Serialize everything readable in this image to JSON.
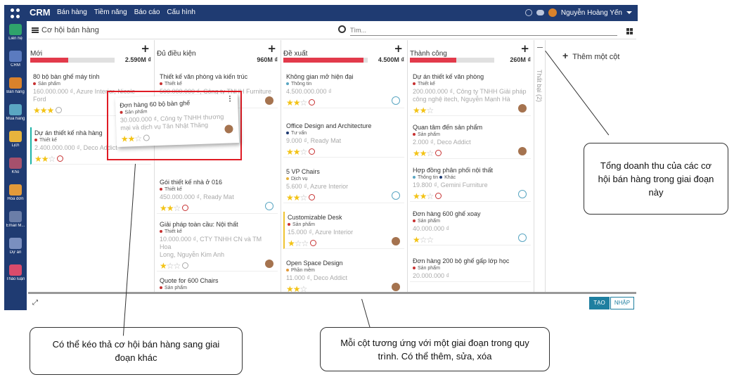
{
  "topbar": {
    "brand": "CRM",
    "menu": [
      "Bán hàng",
      "Tiềm năng",
      "Báo cáo",
      "Cấu hình"
    ],
    "user": "Nguyễn Hoàng Yến"
  },
  "sidebar": [
    {
      "label": "Liên hệ",
      "color": "#2fa36b"
    },
    {
      "label": "CRM",
      "color": "#5b7bbf"
    },
    {
      "label": "Bán hàng",
      "color": "#d9822b"
    },
    {
      "label": "Mua hàng",
      "color": "#5aa6c2"
    },
    {
      "label": "Lịch",
      "color": "#e6b33d"
    },
    {
      "label": "Kho",
      "color": "#a5506c"
    },
    {
      "label": "Hóa đơn",
      "color": "#e29a3a"
    },
    {
      "label": "Email M...",
      "color": "#6b7ea8"
    },
    {
      "label": "Dự án",
      "color": "#7a8fbf"
    },
    {
      "label": "Thảo luận",
      "color": "#d94b6b"
    }
  ],
  "breadcrumb": {
    "title": "Cơ hội bán hàng",
    "search_placeholder": "Tìm..."
  },
  "columns": [
    {
      "name": "Mới",
      "total": "2.590M ₫",
      "progress": 0.45,
      "cards": [
        {
          "title": "80 bộ bàn ghế máy tính",
          "tags": [
            {
              "text": "Sản phẩm",
              "color": "#c73131"
            }
          ],
          "info": [
            "160.000.000 ₫, Azure Interior, Nicole",
            "Ford"
          ],
          "stars": 3,
          "activity": "grey",
          "avatar": "none",
          "border": ""
        },
        {
          "title": "Dự án thiết kế nhà hàng",
          "tags": [
            {
              "text": "Thiết kế",
              "color": "#c73131"
            }
          ],
          "info": [
            "2.400.000.000 ₫, Deco Addict"
          ],
          "stars": 2,
          "activity": "red",
          "avatar": "none",
          "border": "green"
        }
      ]
    },
    {
      "name": "Đủ điều kiện",
      "total": "960M ₫",
      "progress": 0,
      "cards": [
        {
          "title": "Thiết kế văn phòng và kiến trúc",
          "tags": [
            {
              "text": "Thiết kế",
              "color": "#c73131"
            }
          ],
          "info": [
            "500.000.000 ₫, Công ty TNHH Furniture"
          ],
          "stars": 0,
          "activity": "none",
          "avatar": "photo",
          "border": ""
        },
        {
          "title": "Gói thiết kế nhà ở 016",
          "tags": [
            {
              "text": "Thiết kế",
              "color": "#c73131"
            }
          ],
          "info": [
            "450.000.000 ₫, Ready Mat"
          ],
          "stars": 2,
          "activity": "red",
          "avatar": "ring",
          "border": ""
        },
        {
          "title": "Giải pháp toàn cầu: Nội thất",
          "tags": [
            {
              "text": "Thiết kế",
              "color": "#c73131"
            }
          ],
          "info": [
            "10.000.000 ₫, CTY TNHH CN và TM Hoa",
            "Long, Nguyễn Kim Anh"
          ],
          "stars": 1,
          "activity": "grey",
          "avatar": "photo",
          "border": ""
        },
        {
          "title": "Quote for 600 Chairs",
          "tags": [
            {
              "text": "Sản phẩm",
              "color": "#c73131"
            }
          ],
          "info": [],
          "stars": 0,
          "activity": "none",
          "avatar": "none",
          "border": ""
        }
      ]
    },
    {
      "name": "Đề xuất",
      "total": "4.500M ₫",
      "progress": 0.95,
      "cards": [
        {
          "title": "Không gian mở hiện đại",
          "tags": [
            {
              "text": "Thông tin",
              "color": "#5aa6c2"
            }
          ],
          "info": [
            "4.500.000.000 ₫"
          ],
          "stars": 2,
          "activity": "red",
          "avatar": "ring",
          "border": ""
        },
        {
          "title": "Office Design and Architecture",
          "tags": [
            {
              "text": "Tư vấn",
              "color": "#1f3b72"
            }
          ],
          "info": [
            "9.000 ₫, Ready Mat"
          ],
          "stars": 2,
          "activity": "red",
          "avatar": "none",
          "border": ""
        },
        {
          "title": "5 VP Chairs",
          "tags": [
            {
              "text": "Dịch vụ",
              "color": "#e6b33d"
            }
          ],
          "info": [
            "5.600 ₫, Azure Interior"
          ],
          "stars": 2,
          "activity": "red",
          "avatar": "ring",
          "border": ""
        },
        {
          "title": "Customizable Desk",
          "tags": [
            {
              "text": "Sản phẩm",
              "color": "#c73131"
            }
          ],
          "info": [
            "15.000 ₫, Azure Interior"
          ],
          "stars": 1,
          "activity": "red",
          "avatar": "photo",
          "border": "yellow"
        },
        {
          "title": "Open Space Design",
          "tags": [
            {
              "text": "Phần mềm",
              "color": "#e29a3a"
            }
          ],
          "info": [
            "11.000 ₫, Deco Addict"
          ],
          "stars": 2,
          "activity": "none",
          "avatar": "photo",
          "border": ""
        }
      ]
    },
    {
      "name": "Thành công",
      "total": "260M ₫",
      "progress": 0.55,
      "cards": [
        {
          "title": "Dự án thiết kế văn phòng",
          "tags": [
            {
              "text": "Thiết kế",
              "color": "#c73131"
            }
          ],
          "info": [
            "200.000.000 ₫, Công ty TNHH Giải pháp",
            "công nghệ itech, Nguyễn Mạnh Hà"
          ],
          "stars": 2,
          "activity": "none",
          "avatar": "photo",
          "border": ""
        },
        {
          "title": "Quan tâm đến sản phẩm",
          "tags": [
            {
              "text": "Sản phẩm",
              "color": "#c73131"
            }
          ],
          "info": [
            "2.000 ₫, Deco Addict"
          ],
          "stars": 2,
          "activity": "red",
          "avatar": "photo",
          "border": ""
        },
        {
          "title": "Hợp đồng phân phối nội thất",
          "tags": [
            {
              "text": "Thông tin",
              "color": "#5aa6c2"
            },
            {
              "text": "Khác",
              "color": "#1f3b72"
            }
          ],
          "info": [
            "19.800 ₫, Gemini Furniture"
          ],
          "stars": 2,
          "activity": "red",
          "avatar": "ring",
          "border": ""
        },
        {
          "title": "Đơn hàng 600 ghế xoay",
          "tags": [
            {
              "text": "Sản phẩm",
              "color": "#c73131"
            }
          ],
          "info": [
            "40.000.000 ₫"
          ],
          "stars": 1,
          "activity": "none",
          "avatar": "ring",
          "border": ""
        },
        {
          "title": "Đơn hàng 200 bộ ghế gấp lớp học",
          "tags": [
            {
              "text": "Sản phẩm",
              "color": "#c73131"
            }
          ],
          "info": [
            "20.000.000 ₫"
          ],
          "stars": 0,
          "activity": "none",
          "avatar": "none",
          "border": ""
        }
      ]
    }
  ],
  "folded_column": "Thất bại (2)",
  "add_column": "Thêm một cột",
  "drag_card": {
    "title": "Đơn hàng 60 bộ bàn ghế",
    "tag": "Sản phẩm",
    "info": [
      "30.000.000 ₫, Công ty TNHH thương",
      "mại và dịch vụ Tân Nhật Thăng"
    ],
    "stars": 2
  },
  "buttons": {
    "create": "TẠO",
    "import": "NHẬP"
  },
  "callouts": {
    "revenue": "Tổng doanh thu của các cơ hội bán hàng trong giai đoạn này",
    "drag": "Có thể kéo thả cơ hội bán hàng sang giai đoạn khác",
    "stage": "Mỗi cột tương ứng với một giai đoạn trong quy trình. Có thể thêm, sửa, xóa"
  }
}
